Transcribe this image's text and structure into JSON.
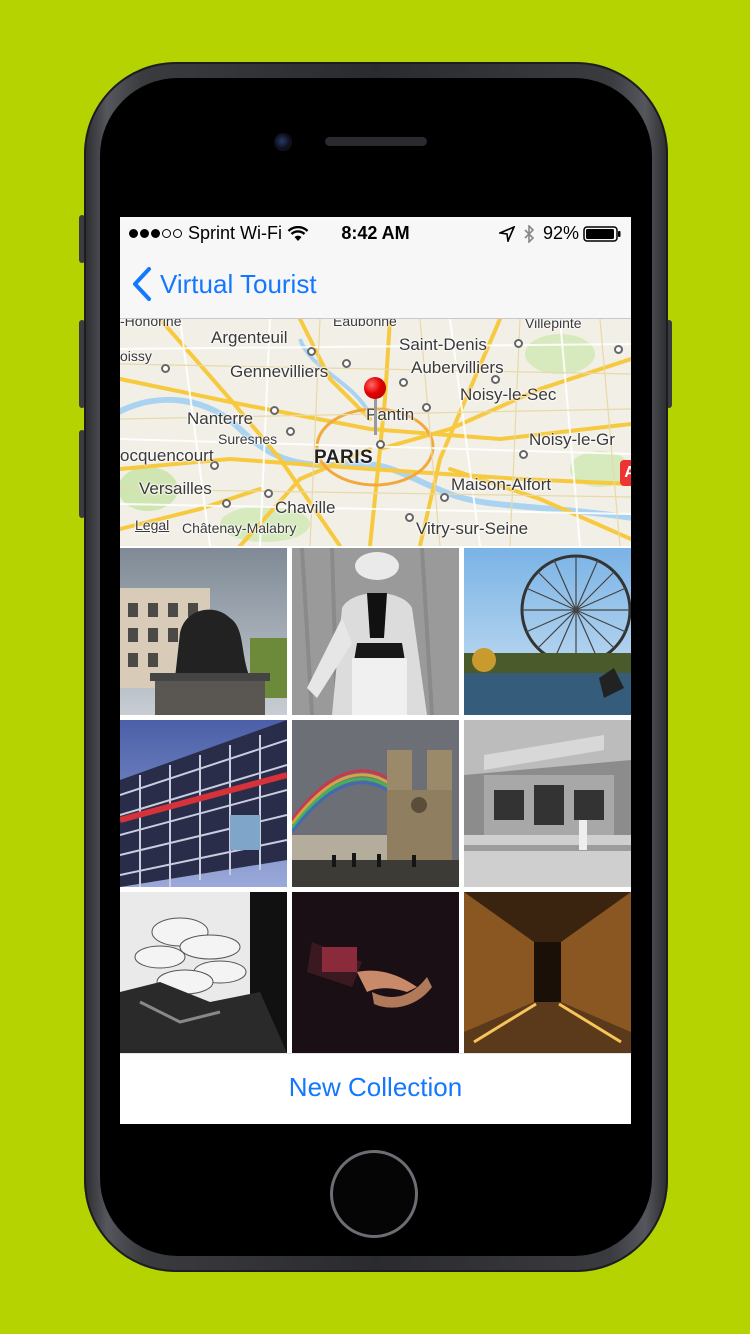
{
  "colors": {
    "background": "#b5d300",
    "accent": "#1478ff",
    "pin": "#e30000"
  },
  "status_bar": {
    "carrier": "Sprint Wi-Fi",
    "time": "8:42 AM",
    "battery": "92%",
    "signal_icons": [
      "filled-dot",
      "filled-dot",
      "filled-dot",
      "empty-dot",
      "empty-dot"
    ],
    "icons": [
      "wifi-icon",
      "location-arrow-icon",
      "bluetooth-icon",
      "battery-icon"
    ]
  },
  "nav": {
    "back_label": "Virtual Tourist",
    "back_icon": "chevron-left-icon"
  },
  "map": {
    "labels": [
      "-Honorine",
      "Eaubonne",
      "Villepinte",
      "Argenteuil",
      "oissy",
      "Saint-Denis",
      "Gennevilliers",
      "Aubervilliers",
      "Noisy-le-Sec",
      "Nanterre",
      "Pantin",
      "Suresnes",
      "Noisy-le-Gr",
      "ocquencourt",
      "PARIS",
      "Versailles",
      "Maison-Alfort",
      "Chaville",
      "Legal",
      "Châtenay-Malabry",
      "Vitry-sur-Seine",
      "A"
    ]
  },
  "photos": [
    "lion-statue-photo",
    "mannequin-photo",
    "ferris-wheel-photo",
    "pompidou-photo",
    "notre-dame-rainbow-photo",
    "studio-raspail-photo",
    "feather-costume-photo",
    "gloved-hands-photo",
    "corridor-photo"
  ],
  "footer": {
    "new_collection_label": "New Collection"
  }
}
